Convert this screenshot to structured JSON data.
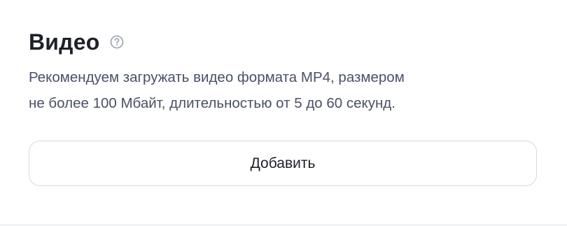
{
  "section": {
    "title": "Видео",
    "help_icon": "question-circle-icon",
    "description_line1": "Рекомендуем загружать видео формата MP4, размером",
    "description_line2": "не более 100 Мбайт, длительностью от 5 до 60 секунд.",
    "add_button_label": "Добавить"
  },
  "colors": {
    "title": "#1f2128",
    "description": "#4a5066",
    "icon": "#9aa0ad",
    "button_border": "#d6d8de",
    "background": "#ffffff"
  }
}
